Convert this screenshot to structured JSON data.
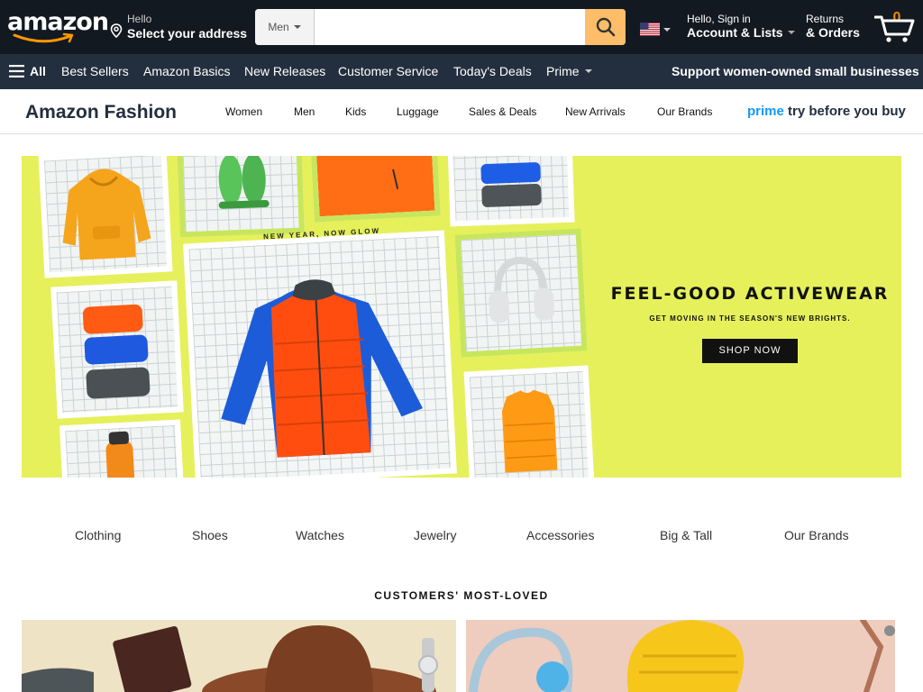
{
  "header": {
    "logo_text": "amazon",
    "deliver": {
      "line1": "Hello",
      "line2": "Select your address"
    },
    "search": {
      "department": "Men",
      "placeholder": ""
    },
    "account": {
      "line1": "Hello, Sign in",
      "line2": "Account & Lists"
    },
    "returns": {
      "line1": "Returns",
      "line2": "& Orders"
    },
    "cart_count": "0"
  },
  "subnav": {
    "all_label": "All",
    "items": [
      "Best Sellers",
      "Amazon Basics",
      "New Releases",
      "Customer Service",
      "Today's Deals",
      "Prime"
    ],
    "promo": "Support women-owned small businesses"
  },
  "fashion": {
    "brand": "Amazon Fashion",
    "nav": [
      "Women",
      "Men",
      "Kids",
      "Luggage",
      "Sales & Deals",
      "New Arrivals",
      "Our Brands"
    ],
    "prime_word": "prime",
    "prime_rest": "try before you buy"
  },
  "hero": {
    "tagline": "NEW YEAR, NOW GLOW",
    "title": "FEEL-GOOD ACTIVEWEAR",
    "subtitle": "GET MOVING IN THE SEASON'S NEW BRIGHTS.",
    "cta": "SHOP NOW",
    "background": "#e6f05a"
  },
  "categories": [
    "Clothing",
    "Shoes",
    "Watches",
    "Jewelry",
    "Accessories",
    "Big & Tall",
    "Our Brands"
  ],
  "section_title": "CUSTOMERS' MOST-LOVED",
  "colors": {
    "nav_dark": "#131921",
    "nav_sub": "#232f3e",
    "search_button": "#febd69",
    "cart_count": "#f08804",
    "prime_blue": "#1399ff"
  }
}
